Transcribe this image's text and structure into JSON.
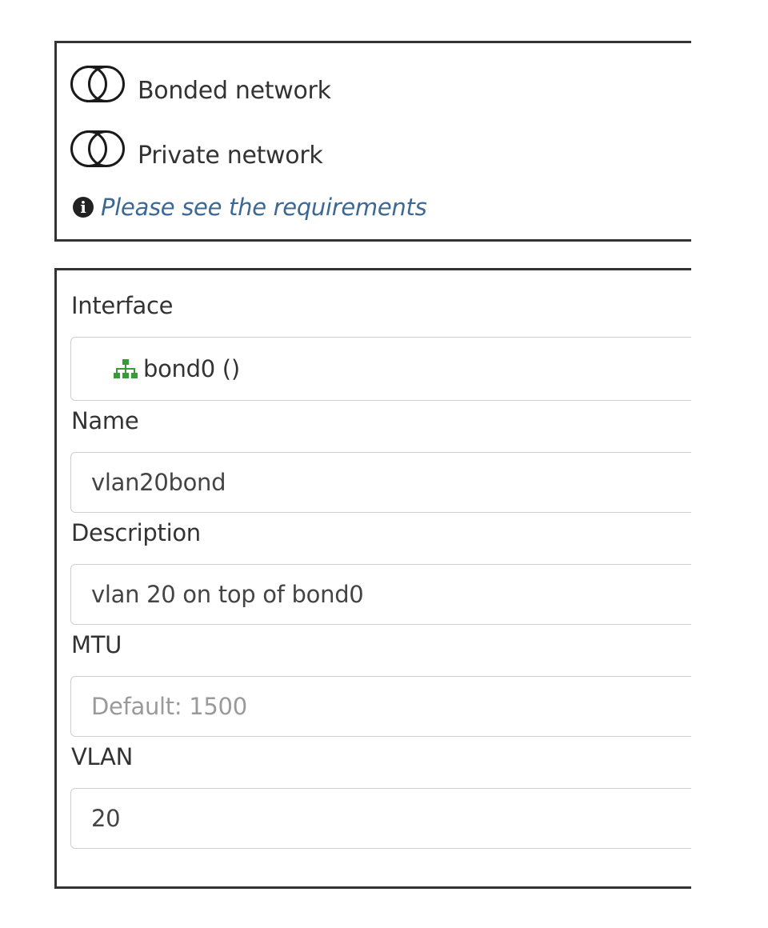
{
  "toggles": {
    "bonded_label": "Bonded network",
    "private_label": "Private network",
    "bonded_on": false,
    "private_on": false
  },
  "note": {
    "icon": "info-circle-icon",
    "text": "Please see the requirements"
  },
  "form": {
    "interface": {
      "label": "Interface",
      "value": "bond0 ()",
      "icon": "network-sitemap-icon",
      "icon_color": "#3a9a3a"
    },
    "name": {
      "label": "Name",
      "value": "vlan20bond"
    },
    "description": {
      "label": "Description",
      "value": "vlan 20 on top of bond0"
    },
    "mtu": {
      "label": "MTU",
      "value": "",
      "placeholder": "Default: 1500"
    },
    "vlan": {
      "label": "VLAN",
      "value": "20"
    }
  },
  "colors": {
    "link": "#3d6894",
    "border": "#333333",
    "input_border": "#cfcfcf"
  }
}
